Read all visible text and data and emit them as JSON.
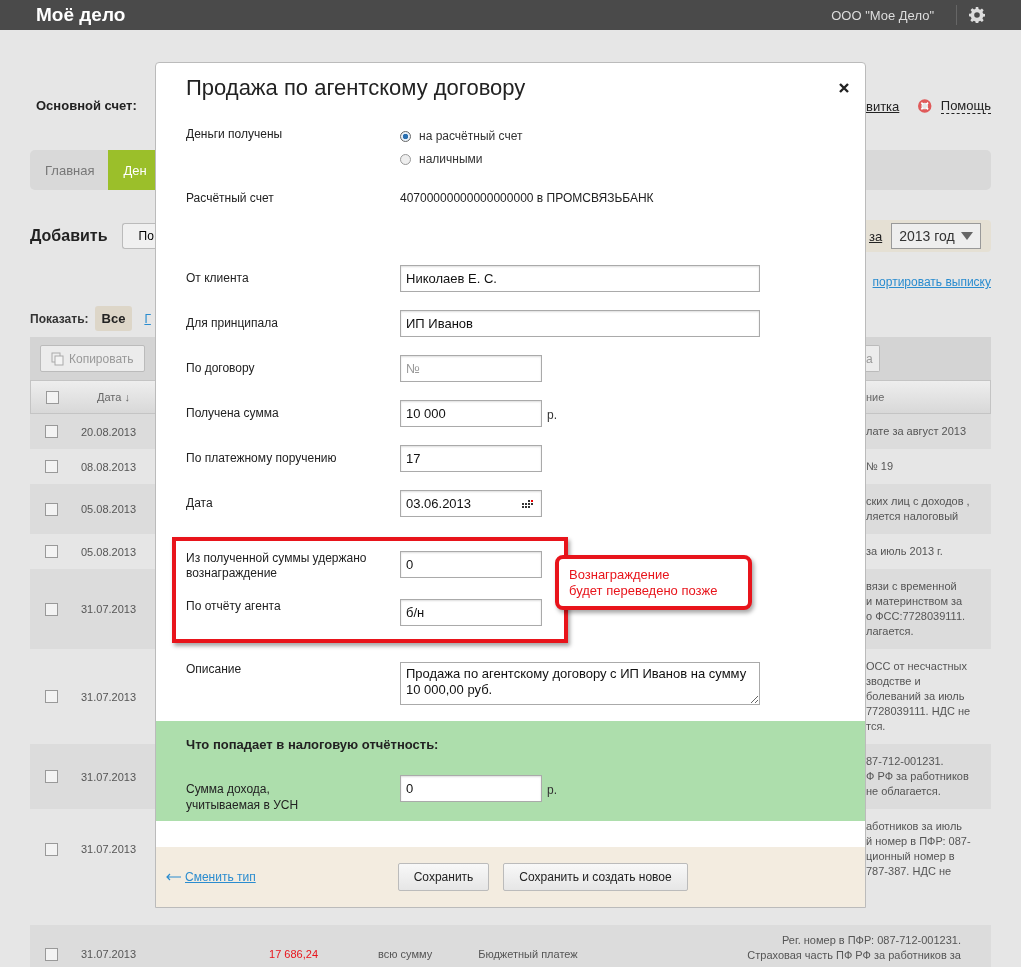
{
  "header": {
    "logo": "Моё дело",
    "company": "ООО \"Мое Дело\""
  },
  "background": {
    "account_label": "Основной счет:",
    "links": [
      "витка",
      "Помощь"
    ],
    "tabs": [
      {
        "label": "Главная",
        "selected": false
      },
      {
        "label": "Ден",
        "selected": true
      }
    ],
    "add_label": "Добавить",
    "add_button": "По",
    "period_link": "за",
    "period_select": "2013 год",
    "export_link": "портировать выписку",
    "show_label": "Показать:",
    "filters": [
      {
        "label": "Все",
        "selected": true
      },
      {
        "label": "Г",
        "selected": false
      }
    ],
    "copy_button": "Копировать",
    "cut_button": "а",
    "columns": [
      "Дата ↓",
      "ние"
    ],
    "select_all_checked": false,
    "rows": [
      {
        "date": "20.08.2013",
        "checked": false,
        "description": "лате за август 2013"
      },
      {
        "date": "08.08.2013",
        "checked": false,
        "description": "№ 19"
      },
      {
        "date": "05.08.2013",
        "checked": false,
        "description": "ских лиц с доходов ,\nляется налоговый"
      },
      {
        "date": "05.08.2013",
        "checked": false,
        "description": "за июль 2013 г."
      },
      {
        "date": "31.07.2013",
        "checked": false,
        "description": "вязи с временной\nи материнством за\nо ФСС:7728039111.\nлагается."
      },
      {
        "date": "31.07.2013",
        "checked": false,
        "description": "ОСС от несчастных\nзводстве и\nболеваний за июль\n7728039111. НДС не\nтся."
      },
      {
        "date": "31.07.2013",
        "checked": false,
        "description": "87-712-001231.\nФ РФ за работников\nне облагается."
      },
      {
        "date": "31.07.2013",
        "checked": false,
        "description": "аботников за июль\nй номер в ПФР: 087-\nционный номер в\n787-387. НДС не"
      }
    ],
    "last_row": {
      "date": "31.07.2013",
      "checked": false,
      "amount": "17 686,24",
      "part": "всю сумму",
      "type": "Бюджетный платеж",
      "description": "Рег. номер в ПФР: 087-712-001231.\nСтраховая часть ПФ РФ за работников за"
    }
  },
  "modal": {
    "title": "Продажа по агентскому договору",
    "rows": [
      {
        "kind": "radio",
        "label": "Деньги получены",
        "options": [
          {
            "label": "на расчётный счет",
            "selected": true
          },
          {
            "label": "наличными",
            "selected": false
          }
        ]
      },
      {
        "kind": "text",
        "label": "Расчётный счет",
        "value": "40700000000000000000 в ПРОМСВЯЗЬБАНК"
      },
      {
        "kind": "wide",
        "label": "От клиента",
        "value": "Николаев Е. С."
      },
      {
        "kind": "wide",
        "label": "Для принципала",
        "value": "ИП Иванов"
      },
      {
        "kind": "short",
        "label": "По договору",
        "placeholder": "№"
      },
      {
        "kind": "short",
        "label": "Получена сумма",
        "value": "10 000",
        "unit": "р."
      },
      {
        "kind": "short",
        "label": "По платежному поручению",
        "value": "17"
      },
      {
        "kind": "date",
        "label": "Дата",
        "value": "03.06.2013"
      }
    ],
    "highlighted": [
      {
        "label": "Из полученной суммы удержано вознаграждение",
        "value": "0"
      },
      {
        "label": "По отчёту агента",
        "value": "б/н"
      }
    ],
    "callout": "Вознаграждение\nбудет переведено позже",
    "description": {
      "label": "Описание",
      "value": "Продажа по агентскому договору с ИП Иванов на сумму 10 000,00 руб."
    },
    "tax": {
      "title": "Что попадает в налоговую отчётность:",
      "label": "Сумма дохода, учитываемая в УСН",
      "value": "0",
      "unit": "р."
    },
    "back_link": "Сменить тип",
    "buttons": [
      "Сохранить",
      "Сохранить и создать новое"
    ]
  }
}
